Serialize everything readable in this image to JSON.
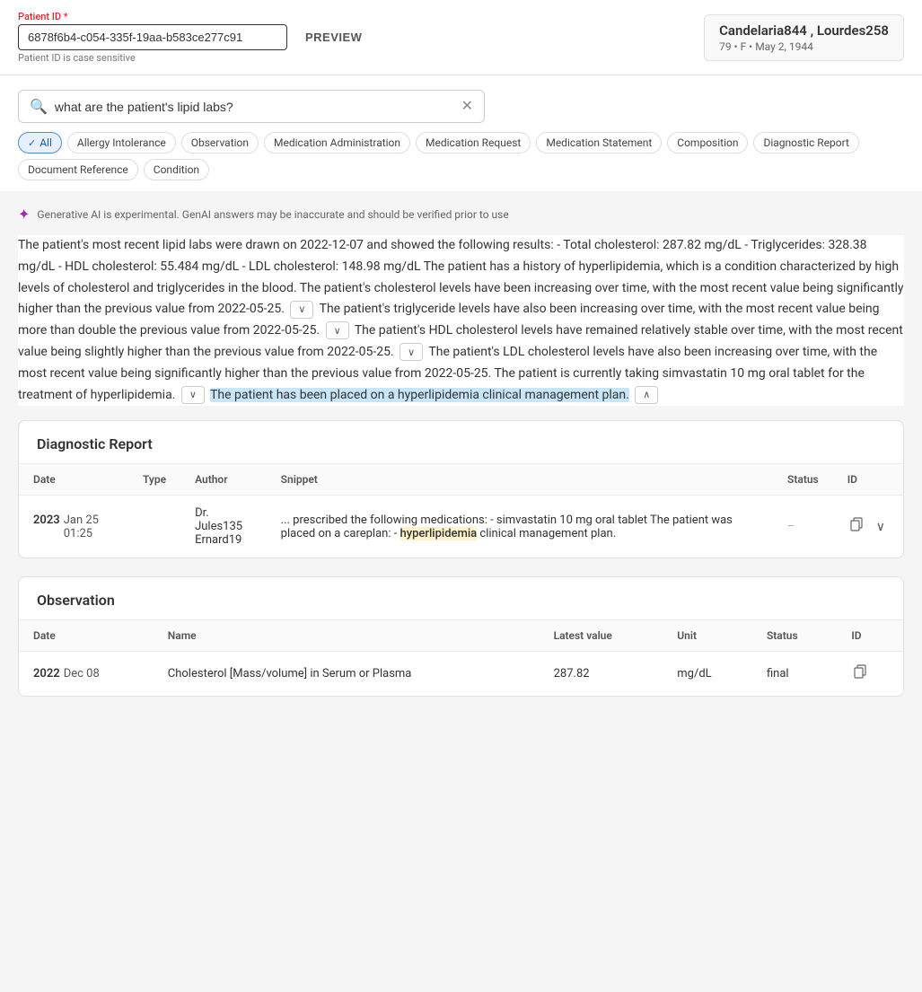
{
  "topBar": {
    "patientIdLabel": "Patient ID",
    "required": "*",
    "patientIdValue": "6878f6b4-c054-335f-19aa-b583ce277c91",
    "patientIdHint": "Patient ID is case sensitive",
    "previewLabel": "PREVIEW",
    "patientName": "Candelaria844 , Lourdes258",
    "patientDetails": "79 • F • May 2, 1944"
  },
  "search": {
    "placeholder": "what are the patient's lipid labs?",
    "value": "what are the patient's lipid labs?",
    "clearTitle": "Clear"
  },
  "filters": {
    "chips": [
      {
        "id": "all",
        "label": "All",
        "active": true
      },
      {
        "id": "allergy",
        "label": "Allergy Intolerance",
        "active": false
      },
      {
        "id": "observation",
        "label": "Observation",
        "active": false
      },
      {
        "id": "med-admin",
        "label": "Medication Administration",
        "active": false
      },
      {
        "id": "med-request",
        "label": "Medication Request",
        "active": false
      },
      {
        "id": "med-statement",
        "label": "Medication Statement",
        "active": false
      },
      {
        "id": "composition",
        "label": "Composition",
        "active": false
      },
      {
        "id": "diag-report",
        "label": "Diagnostic Report",
        "active": false
      },
      {
        "id": "doc-ref",
        "label": "Document Reference",
        "active": false
      },
      {
        "id": "condition",
        "label": "Condition",
        "active": false
      }
    ]
  },
  "aiNotice": {
    "text": "Generative AI is experimental. GenAI answers may be inaccurate and should be verified prior to use"
  },
  "aiText": {
    "part1": "The patient's most recent lipid labs were drawn on 2022-12-07 and showed the following results: - Total cholesterol: 287.82 mg/dL - Triglycerides: 328.38 mg/dL - HDL cholesterol: 55.484 mg/dL - LDL cholesterol: 148.98 mg/dL The patient has a history of hyperlipidemia, which is a condition characterized by high levels of cholesterol and triglycerides in the blood. The patient's cholesterol levels have been increasing over time, with the most recent value being significantly higher than the previous value from 2022-05-25.",
    "part2": "The patient's triglyceride levels have also been increasing over time, with the most recent value being more than double the previous value from 2022-05-25.",
    "part3": "The patient's HDL cholesterol levels have remained relatively stable over time, with the most recent value being slightly higher than the previous value from 2022-05-25.",
    "part4": "The patient's LDL cholesterol levels have also been increasing over time, with the most recent value being significantly higher than the previous value from 2022-05-25. The patient is currently taking simvastatin 10 mg oral tablet for the treatment of hyperlipidemia.",
    "part5": "The patient has been placed on a hyperlipidemia clinical management plan."
  },
  "diagnosticReport": {
    "title": "Diagnostic Report",
    "columns": {
      "date": "Date",
      "type": "Type",
      "author": "Author",
      "snippet": "Snippet",
      "status": "Status",
      "id": "ID"
    },
    "rows": [
      {
        "dateYear": "2023",
        "dateRest": "Jan  25  01:25",
        "type": "",
        "author1": "Dr. Jules135",
        "author2": "Ernard19",
        "snippetPre": "... prescribed the following medications: - simvastatin 10 mg oral tablet The patient was placed on a careplan: - ",
        "snippetHighlight": "hyperlipidemia",
        "snippetPost": " clinical management plan.",
        "status": "–",
        "id": ""
      }
    ]
  },
  "observation": {
    "title": "Observation",
    "columns": {
      "date": "Date",
      "name": "Name",
      "latestValue": "Latest value",
      "unit": "Unit",
      "status": "Status",
      "id": "ID"
    },
    "rows": [
      {
        "dateYear": "2022",
        "dateRest": "Dec  08",
        "name": "Cholesterol [Mass/volume] in Serum or Plasma",
        "latestValue": "287.82",
        "unit": "mg/dL",
        "status": "final",
        "id": ""
      }
    ]
  }
}
